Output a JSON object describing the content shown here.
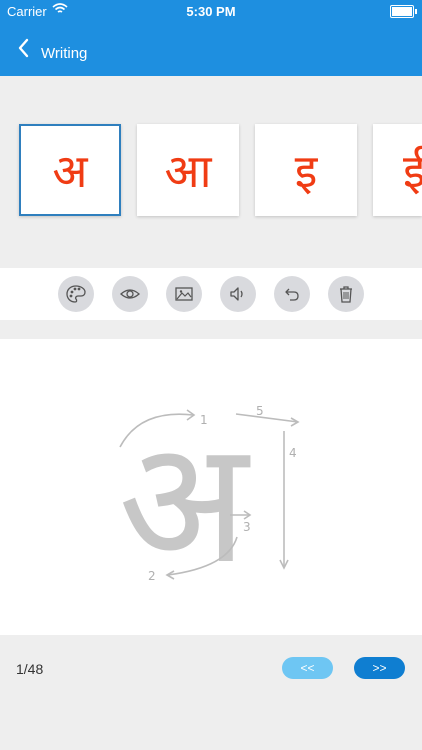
{
  "status_bar": {
    "carrier": "Carrier",
    "time": "5:30 PM"
  },
  "header": {
    "title": "Writing"
  },
  "letters": [
    {
      "char": "अ",
      "selected": true
    },
    {
      "char": "आ",
      "selected": false
    },
    {
      "char": "इ",
      "selected": false
    },
    {
      "char": "ई",
      "selected": false
    }
  ],
  "tools": [
    {
      "icon": "palette-icon"
    },
    {
      "icon": "eye-icon"
    },
    {
      "icon": "image-icon"
    },
    {
      "icon": "speaker-icon"
    },
    {
      "icon": "undo-icon"
    },
    {
      "icon": "trash-icon"
    }
  ],
  "tracing": {
    "letter": "अ",
    "strokes": [
      "1",
      "2",
      "3",
      "4",
      "5"
    ]
  },
  "footer": {
    "page": "1/48",
    "prev_label": "<<",
    "next_label": ">>"
  },
  "colors": {
    "primary": "#1e8fe0",
    "letter": "#f03c14",
    "tool_bg": "#d9dade",
    "trace": "#c7c7c7"
  }
}
